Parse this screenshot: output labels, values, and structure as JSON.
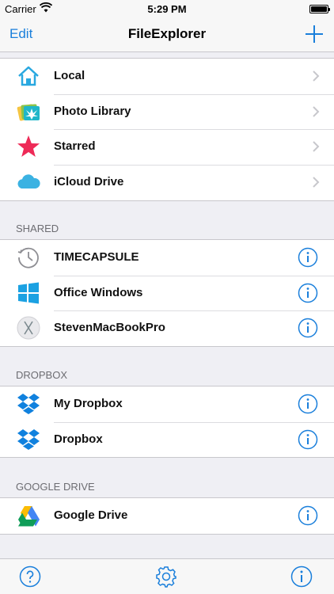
{
  "status_bar": {
    "carrier": "Carrier",
    "time": "5:29 PM"
  },
  "nav": {
    "edit_label": "Edit",
    "title": "FileExplorer"
  },
  "local_items": [
    {
      "label": "Local",
      "icon": "house-icon"
    },
    {
      "label": "Photo Library",
      "icon": "photos-icon"
    },
    {
      "label": "Starred",
      "icon": "star-icon"
    },
    {
      "label": "iCloud Drive",
      "icon": "cloud-icon"
    }
  ],
  "sections": [
    {
      "title": "SHARED",
      "items": [
        {
          "label": "TIMECAPSULE",
          "icon": "clock-icon"
        },
        {
          "label": "Office Windows",
          "icon": "windows-icon"
        },
        {
          "label": "StevenMacBookPro",
          "icon": "osx-icon"
        }
      ]
    },
    {
      "title": "DROPBOX",
      "items": [
        {
          "label": "My Dropbox",
          "icon": "dropbox-icon"
        },
        {
          "label": "Dropbox",
          "icon": "dropbox-icon"
        }
      ]
    },
    {
      "title": "GOOGLE DRIVE",
      "items": [
        {
          "label": "Google Drive",
          "icon": "google-drive-icon"
        }
      ]
    }
  ],
  "colors": {
    "accent": "#1a7fdb",
    "star": "#ee2a57",
    "house": "#29a8e0",
    "cloud": "#3bb2e2"
  }
}
